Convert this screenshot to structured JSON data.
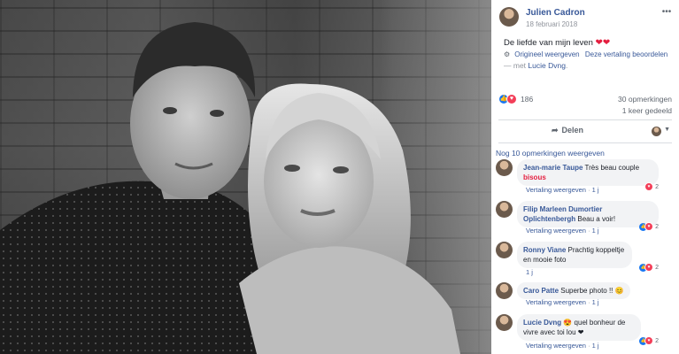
{
  "post": {
    "author": "Julien Cadron",
    "date": "18 februari 2018",
    "text": "De liefde van mijn leven",
    "text_emoji": "❤❤",
    "translate_original": "Origineel weergeven",
    "translate_rate": "Deze vertaling beoordelen",
    "with_prefix": "— met",
    "with_name": "Lucie Dvng",
    "with_suffix": "."
  },
  "reactions": {
    "count": "186",
    "comments": "30 opmerkingen",
    "shares": "1 keer gedeeld"
  },
  "actions": {
    "share_label": "Delen"
  },
  "comments": {
    "more_label": "Nog 10 opmerkingen weergeven",
    "items": [
      {
        "name": "Jean-marie Taupe",
        "text": "Très beau couple",
        "extra": "bisous",
        "actions": "Vertaling weergeven",
        "sep": "·",
        "time": "1 j",
        "react_count": "2"
      },
      {
        "name": "Filip Marleen Dumortier Oplichtenbergh",
        "text": "Beau a voir!",
        "actions": "Vertaling weergeven",
        "sep": "·",
        "time": "1 j",
        "react_count": "2"
      },
      {
        "name": "Ronny Viane",
        "text": "Prachtig koppeltje en mooie foto",
        "actions": "",
        "sep": "",
        "time": "1 j",
        "react_count": "2"
      },
      {
        "name": "Caro Patte",
        "text": "Superbe photo !! 😊",
        "actions": "Vertaling weergeven",
        "sep": "·",
        "time": "1 j",
        "react_count": ""
      },
      {
        "name": "Lucie Dvng",
        "text": "😍 quel bonheur de vivre avec toi lou ❤",
        "actions": "Vertaling weergeven",
        "sep": "·",
        "time": "1 j",
        "react_count": "2"
      }
    ]
  },
  "colors": {
    "link": "#385898",
    "like": "#1877f2",
    "love": "#f33e58"
  }
}
